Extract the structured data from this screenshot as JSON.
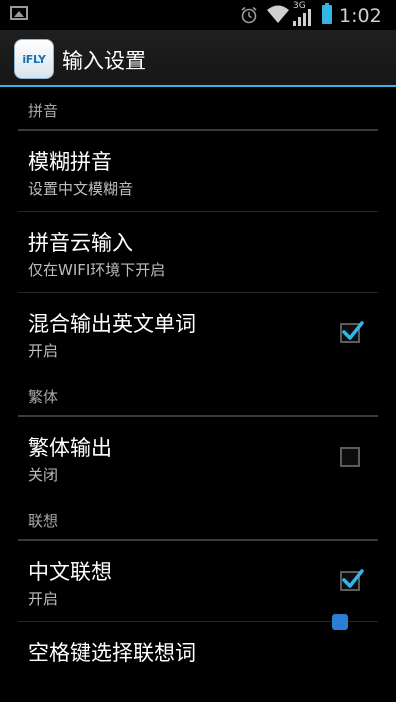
{
  "status_bar": {
    "time": "1:02",
    "network": "3G",
    "icons": [
      "image-icon",
      "alarm-icon",
      "wifi-icon",
      "signal-icon",
      "battery-icon"
    ]
  },
  "action_bar": {
    "app_icon_text": "iFLY",
    "title": "输入设置"
  },
  "sections": [
    {
      "category": "拼音",
      "prefs": [
        {
          "title": "模糊拼音",
          "summary": "设置中文模糊音"
        },
        {
          "title": "拼音云输入",
          "summary": "仅在WIFI环境下开启"
        },
        {
          "title": "混合输出英文单词",
          "summary": "开启",
          "checked": true
        }
      ]
    },
    {
      "category": "繁体",
      "prefs": [
        {
          "title": "繁体输出",
          "summary": "关闭",
          "checked": false
        }
      ]
    },
    {
      "category": "联想",
      "prefs": [
        {
          "title": "中文联想",
          "summary": "开启",
          "checked": true
        },
        {
          "title": "空格键选择联想词",
          "summary": ""
        }
      ]
    }
  ],
  "colors": {
    "accent": "#33b5e5",
    "background": "#000000",
    "category_text": "#a8a8a8"
  }
}
